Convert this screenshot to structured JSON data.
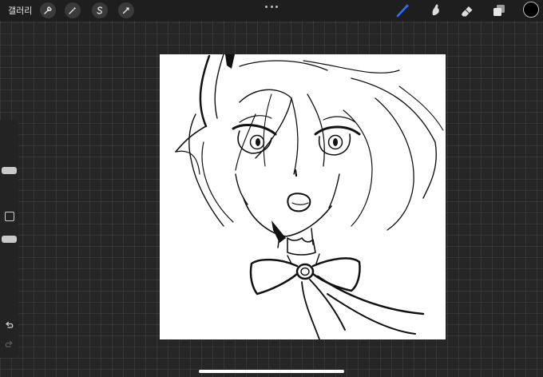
{
  "topbar": {
    "gallery_label": "갤러리",
    "left_tools": [
      "wrench-icon",
      "magic-wand-icon",
      "selection-s-icon",
      "transform-arrow-icon"
    ],
    "more_icon": "more-dots-icon",
    "right_tools": [
      "brush-icon",
      "smudge-icon",
      "eraser-icon",
      "layers-icon"
    ],
    "active_tool": "brush",
    "accent_color": "#2f6df6",
    "current_color": "#000000"
  },
  "sidebar": {
    "brush_size_level": 0.68,
    "opacity_level": 0.32,
    "modify_icon": "square-icon",
    "undo_icon": "undo-icon",
    "redo_icon": "redo-icon"
  },
  "canvas": {
    "background": "#ffffff",
    "content": "line-art-drawing"
  }
}
